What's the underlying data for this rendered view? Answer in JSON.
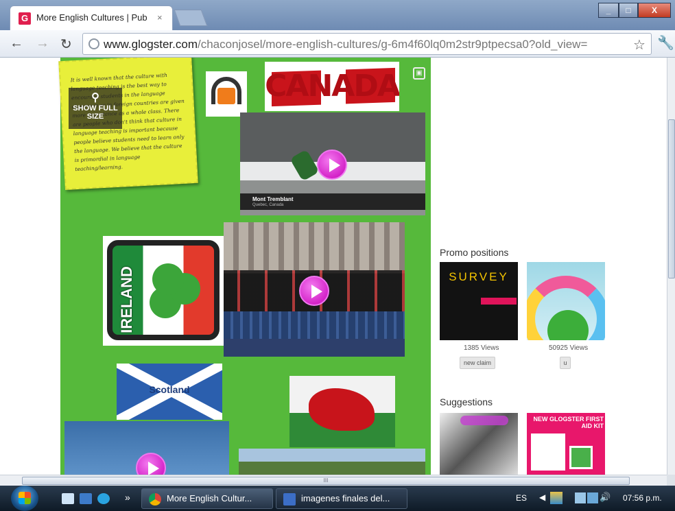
{
  "browser": {
    "tab_title": "More English Cultures | Pub",
    "tab_close": "×",
    "favicon_letter": "G",
    "url_domain": "www.glogster.com",
    "url_path": "/chaconjosel/more-english-cultures/g-6m4f60lq0m2str9ptpecsa0?old_view=",
    "back_icon": "back-arrow-icon",
    "forward_icon": "forward-arrow-icon",
    "reload_icon": "reload-icon",
    "win_min": "_",
    "win_max": "□",
    "win_close": "X"
  },
  "glog": {
    "background": "#56b93b",
    "note_text": "It is well known that the culture with language teaching is the best way to encourage students in the language classroom or in foreign countries are given more importance as a whole class. There are people who don't think that culture in language teaching is important because people believe students need to learn only the language. We believe that the culture is primordial in language teaching/learning.",
    "show_full_size": "SHOW FULL SIZE",
    "canada_label": "CANADA",
    "video1_caption": "Mont Tremblant",
    "video1_subcaption": "Quebec, Canada",
    "ireland_label": "IRELAND",
    "scotland_label": "Scotland"
  },
  "sidebar": {
    "promo_heading": "Promo positions",
    "promo_items": [
      {
        "title": "SURVEY",
        "views": "1385 Views",
        "button": "new claim"
      },
      {
        "title": "",
        "views": "50925 Views",
        "button": "u"
      }
    ],
    "suggestions_heading": "Suggestions",
    "suggestion_items": [
      {
        "title": ""
      },
      {
        "title": "NEW GLOGSTER FIRST AID KIT"
      }
    ]
  },
  "scrollbar": {
    "grip": "III"
  },
  "taskbar": {
    "tasks": [
      {
        "label": "More English Cultur..."
      },
      {
        "label": "imagenes finales del..."
      }
    ],
    "language": "ES",
    "clock": "07:56 p.m.",
    "chevron": "»"
  }
}
